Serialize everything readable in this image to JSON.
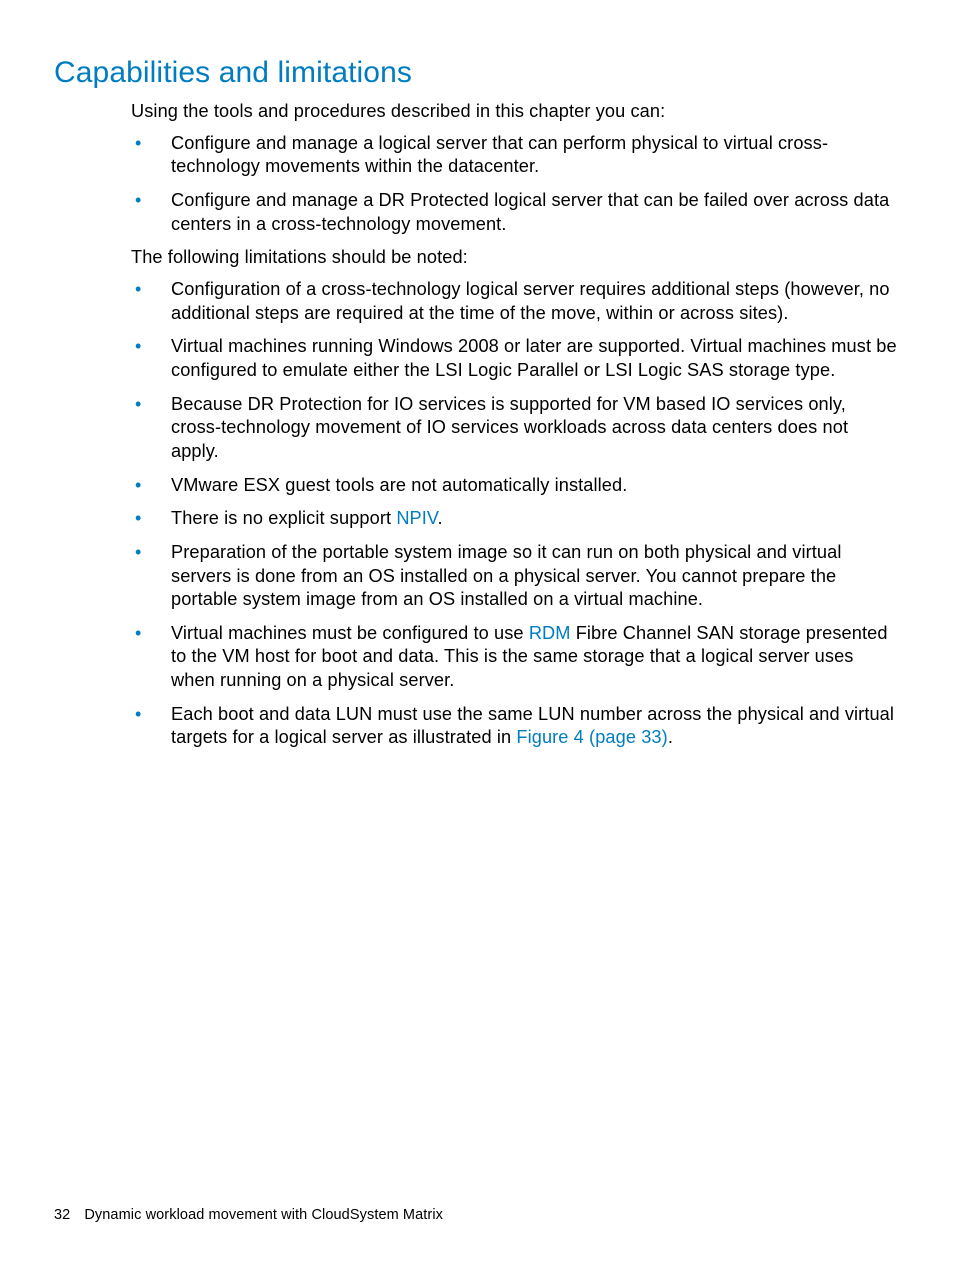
{
  "heading": "Capabilities and limitations",
  "intro1": "Using the tools and procedures described in this chapter you can:",
  "caps": [
    "Configure and manage a logical server that can perform physical to virtual cross-technology movements within the datacenter.",
    "Configure and manage a DR Protected logical server that can be failed over across data centers in a cross-technology movement."
  ],
  "intro2": "The following limitations should be noted:",
  "lim1": "Configuration of a cross-technology logical server requires additional steps (however, no additional steps are required at the time of the move, within or across sites).",
  "lim2": "Virtual machines running Windows 2008 or later are supported. Virtual machines must be configured to emulate either the LSI Logic Parallel or LSI Logic SAS storage type.",
  "lim3": "Because DR Protection for IO services is supported for VM based IO services only, cross-technology movement of IO services workloads across data centers does not apply.",
  "lim4": "VMware ESX guest tools are not automatically installed.",
  "lim5_a": "There is no explicit support ",
  "lim5_link": "NPIV",
  "lim5_b": ".",
  "lim6": "Preparation of the portable system image so it can run on both physical and virtual servers is done from an OS installed on a physical server. You cannot prepare the portable system image from an OS installed on a virtual machine.",
  "lim7_a": "Virtual machines must be configured to use ",
  "lim7_link": "RDM",
  "lim7_b": " Fibre Channel SAN storage presented to the VM host for boot and data. This is the same storage that a logical server uses when running on a physical server.",
  "lim8_a": "Each boot and data LUN must use the same LUN number across the physical and virtual targets for a logical server as illustrated in ",
  "lim8_link": "Figure 4 (page 33)",
  "lim8_b": ".",
  "footer_page": "32",
  "footer_title": "Dynamic workload movement with CloudSystem Matrix"
}
